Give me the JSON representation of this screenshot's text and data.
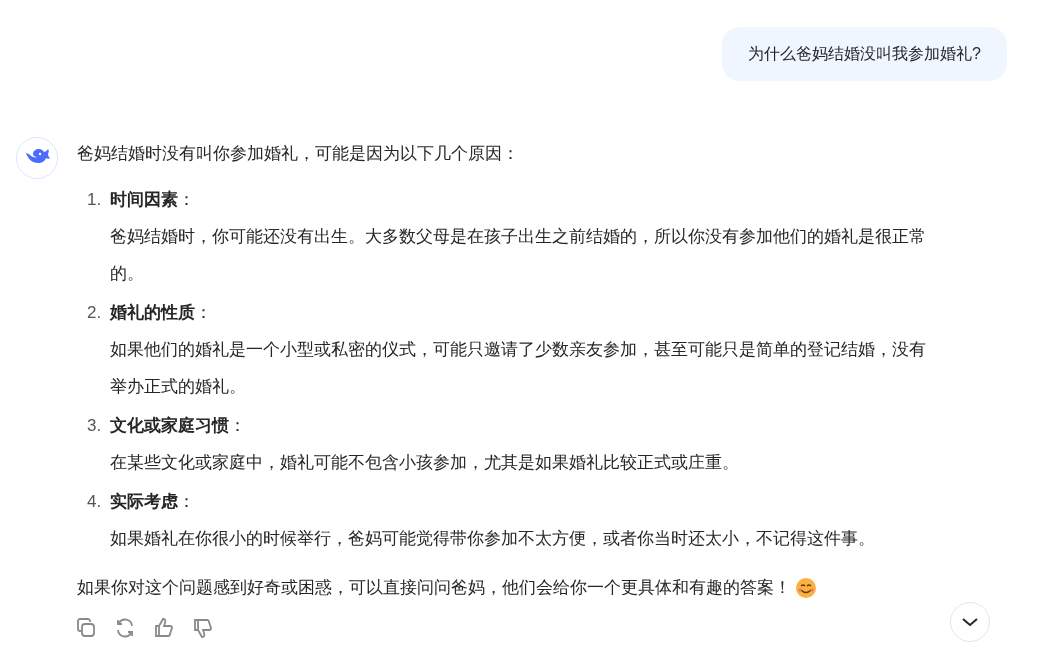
{
  "user_message": "为什么爸妈结婚没叫我参加婚礼?",
  "answer": {
    "intro": "爸妈结婚时没有叫你参加婚礼，可能是因为以下几个原因：",
    "points": [
      {
        "number": "1.",
        "title": "时间因素",
        "colon": "：",
        "body": "爸妈结婚时，你可能还没有出生。大多数父母是在孩子出生之前结婚的，所以你没有参加他们的婚礼是很正常的。"
      },
      {
        "number": "2.",
        "title": "婚礼的性质",
        "colon": "：",
        "body": "如果他们的婚礼是一个小型或私密的仪式，可能只邀请了少数亲友参加，甚至可能只是简单的登记结婚，没有举办正式的婚礼。"
      },
      {
        "number": "3.",
        "title": "文化或家庭习惯",
        "colon": "：",
        "body": "在某些文化或家庭中，婚礼可能不包含小孩参加，尤其是如果婚礼比较正式或庄重。"
      },
      {
        "number": "4.",
        "title": "实际考虑",
        "colon": "：",
        "body": "如果婚礼在你很小的时候举行，爸妈可能觉得带你参加不太方便，或者你当时还太小，不记得这件事。"
      }
    ],
    "closing": "如果你对这个问题感到好奇或困惑，可以直接问问爸妈，他们会给你一个更具体和有趣的答案！"
  },
  "actions": [
    {
      "kind": "copy"
    },
    {
      "kind": "regenerate"
    },
    {
      "kind": "like"
    },
    {
      "kind": "dislike"
    }
  ]
}
